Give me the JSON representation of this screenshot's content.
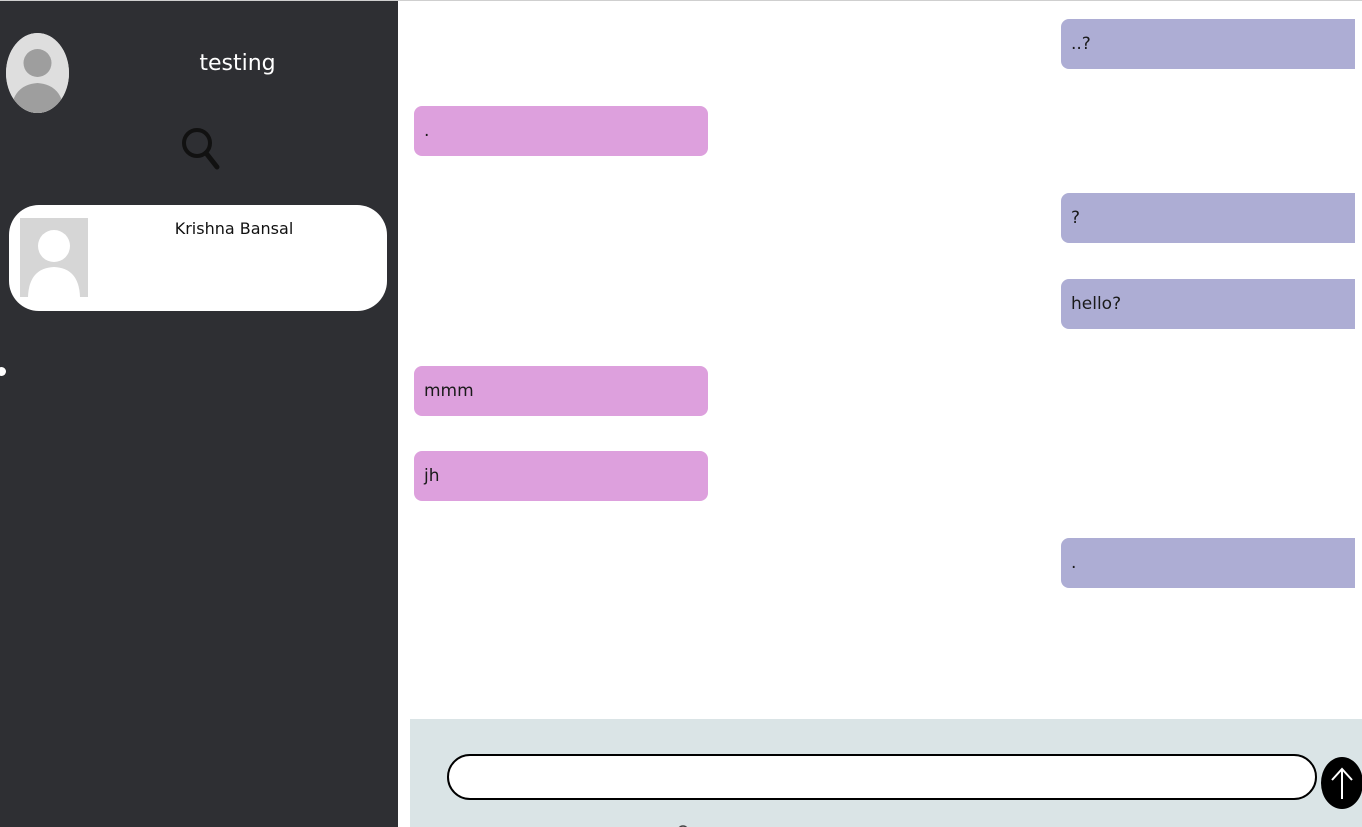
{
  "user": {
    "name": "testing"
  },
  "sidebar": {
    "search_icon": "search-icon",
    "contacts": [
      {
        "name": "Krishna Bansal"
      }
    ]
  },
  "messages": [
    {
      "direction": "outgoing",
      "text": "..?"
    },
    {
      "direction": "incoming",
      "text": "."
    },
    {
      "direction": "outgoing",
      "text": "?"
    },
    {
      "direction": "outgoing",
      "text": "hello?"
    },
    {
      "direction": "incoming",
      "text": "mmm"
    },
    {
      "direction": "incoming",
      "text": "jh"
    },
    {
      "direction": "outgoing",
      "text": "."
    }
  ],
  "composer": {
    "value": "",
    "placeholder": "",
    "send_icon": "arrow-up-icon"
  },
  "colors": {
    "sidebar_bg": "#2e2f33",
    "outgoing_bubble": "#adadd4",
    "incoming_bubble": "#dda0dd",
    "composer_bg": "#dae4e6"
  }
}
